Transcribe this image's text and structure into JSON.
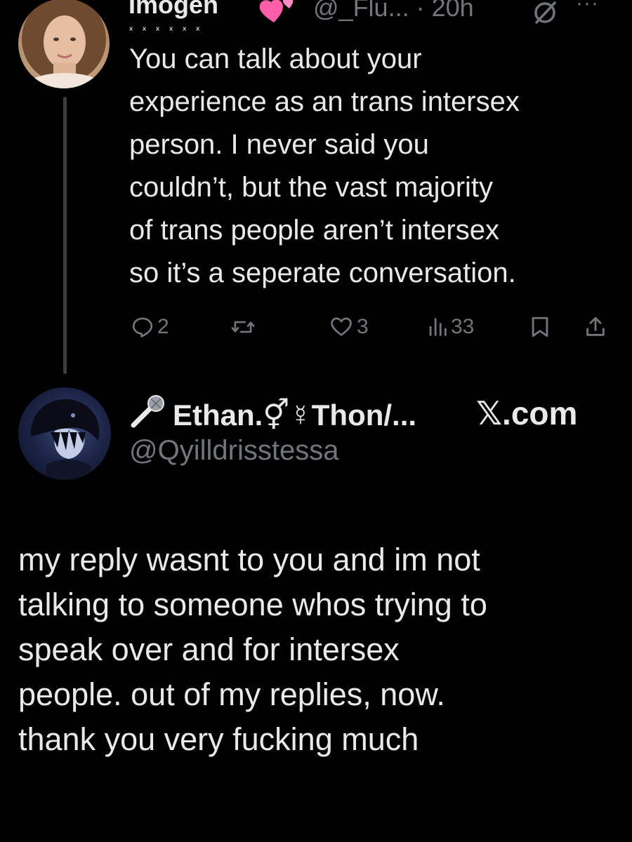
{
  "tweet1": {
    "author_name": "Imogen",
    "name_emoji": "💕",
    "decor": "ˣ ˣ ˣ ˣ ˣ ˣ",
    "handle_time": "@_Flu... · 20h",
    "body": "You can talk about your\nexperience as an trans intersex\nperson. I never said you\ncouldn’t, but the vast majority\nof trans people aren’t intersex\nso it’s a seperate conversation.",
    "actions": {
      "reply_count": "2",
      "retweet_count": "",
      "like_count": "3",
      "views_count": "33"
    },
    "more_label": "···"
  },
  "tweet2": {
    "author_name": "Ethan.⚥☿Thon/...",
    "handle": "@Qyilldrisstessa",
    "watermark": "𝕏.com",
    "body": "my reply wasnt to you and im not\ntalking to someone whos trying to\nspeak over and for intersex\npeople. out of my replies, now.\nthank you very fucking much"
  },
  "colors": {
    "background": "#000000",
    "text_primary": "#e7e9ea",
    "text_secondary": "#71767b",
    "thread_line": "#3a3d40",
    "heart_pink": "#ff5fa8"
  },
  "icons": {
    "reply": "reply-icon",
    "retweet": "retweet-icon",
    "like": "heart-icon",
    "views": "views-icon",
    "bookmark": "bookmark-icon",
    "share": "share-icon",
    "grok": "grok-icon",
    "mic": "microphone-icon"
  }
}
